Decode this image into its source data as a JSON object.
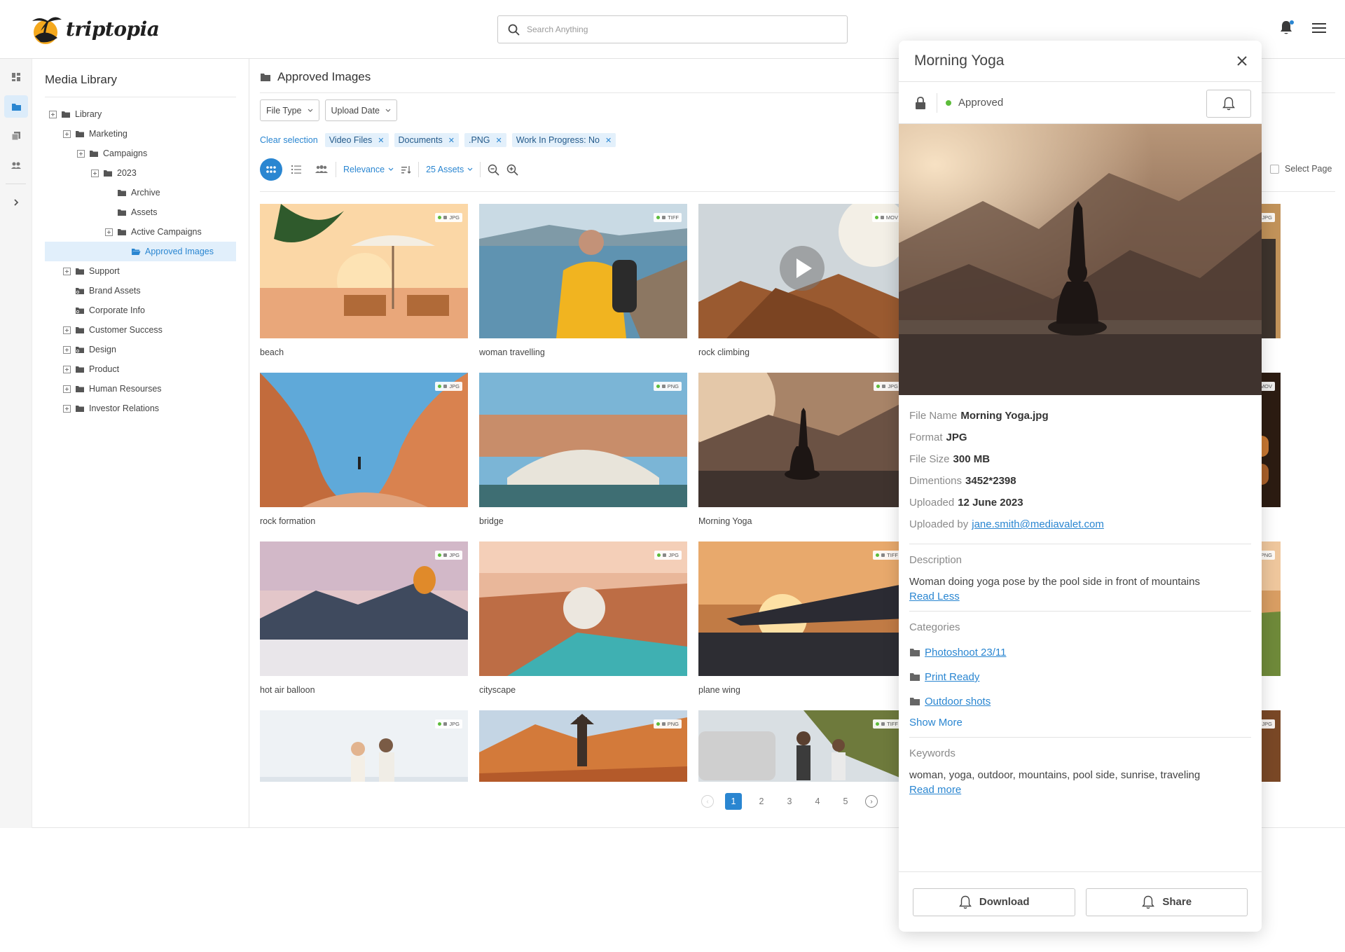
{
  "app": {
    "logo_text": "triptopia"
  },
  "search": {
    "placeholder": "Search Anything"
  },
  "tree": {
    "title": "Media Library",
    "items": [
      {
        "label": "Library"
      },
      {
        "label": "Marketing"
      },
      {
        "label": "Campaigns"
      },
      {
        "label": "2023"
      },
      {
        "label": "Archive"
      },
      {
        "label": "Assets"
      },
      {
        "label": "Active Campaigns"
      },
      {
        "label": "Approved Images"
      },
      {
        "label": "Support"
      },
      {
        "label": "Brand Assets"
      },
      {
        "label": "Corporate Info"
      },
      {
        "label": "Customer Success"
      },
      {
        "label": "Design"
      },
      {
        "label": "Product"
      },
      {
        "label": "Human Resourses"
      },
      {
        "label": "Investor Relations"
      }
    ]
  },
  "main": {
    "title": "Approved Images",
    "filters": {
      "file_type": "File Type",
      "upload_date": "Upload Date"
    },
    "clear_selection": "Clear selection",
    "chips": [
      "Video Files",
      "Documents",
      ".PNG",
      "Work In Progress: No"
    ],
    "sort": "Relevance",
    "asset_count": "25 Assets",
    "select_page": "Select Page"
  },
  "assets": [
    {
      "name": "beach",
      "type": "JPG"
    },
    {
      "name": "woman travelling",
      "type": "TIFF"
    },
    {
      "name": "rock climbing",
      "type": "MOV"
    },
    {
      "name": "",
      "type": "JPG"
    },
    {
      "name": "rock formation",
      "type": "JPG"
    },
    {
      "name": "bridge",
      "type": "PNG"
    },
    {
      "name": "Morning Yoga",
      "type": "JPG"
    },
    {
      "name": "",
      "type": "MOV"
    },
    {
      "name": "hot air balloon",
      "type": "JPG"
    },
    {
      "name": "cityscape",
      "type": "JPG"
    },
    {
      "name": "plane wing",
      "type": "TIFF"
    },
    {
      "name": "",
      "type": "PNG"
    },
    {
      "name": "",
      "type": "JPG"
    },
    {
      "name": "",
      "type": "PNG"
    },
    {
      "name": "",
      "type": "TIFF"
    },
    {
      "name": "",
      "type": "JPG"
    }
  ],
  "pagination": {
    "pages": [
      "1",
      "2",
      "3",
      "4",
      "5"
    ],
    "current": "1"
  },
  "detail": {
    "title": "Morning Yoga",
    "status": "Approved",
    "meta": [
      {
        "label": "File Name",
        "value": "Morning Yoga.jpg"
      },
      {
        "label": "Format",
        "value": "JPG"
      },
      {
        "label": "File Size",
        "value": "300 MB"
      },
      {
        "label": "Dimentions",
        "value": "3452*2398"
      },
      {
        "label": "Uploaded",
        "value": "12 June 2023"
      }
    ],
    "uploaded_by_label": "Uploaded by",
    "uploaded_by": "jane.smith@mediavalet.com",
    "description_label": "Description",
    "description": "Woman doing yoga pose by the pool side in front of mountains",
    "read_less": "Read Less",
    "categories_label": "Categories",
    "categories": [
      "Photoshoot 23/11",
      "Print Ready",
      "Outdoor shots"
    ],
    "show_more": "Show More",
    "keywords_label": "Keywords",
    "keywords": "woman, yoga, outdoor, mountains, pool side, sunrise, traveling",
    "read_more": "Read more",
    "download": "Download",
    "share": "Share"
  },
  "colors": {
    "accent": "#2a86d1",
    "approved": "#5cbc3a",
    "selected_bg": "#e1effb"
  },
  "icons": [
    "logo-palm-icon",
    "search-icon",
    "bell-icon",
    "hamburger-icon",
    "dashboard-icon",
    "folder-icon",
    "copy-icon",
    "people-icon",
    "chevron-right-icon",
    "plus-box-icon",
    "grid-view-icon",
    "list-view-icon",
    "sort-icon",
    "zoom-out-icon",
    "zoom-in-icon",
    "play-icon",
    "lock-icon",
    "close-icon"
  ]
}
